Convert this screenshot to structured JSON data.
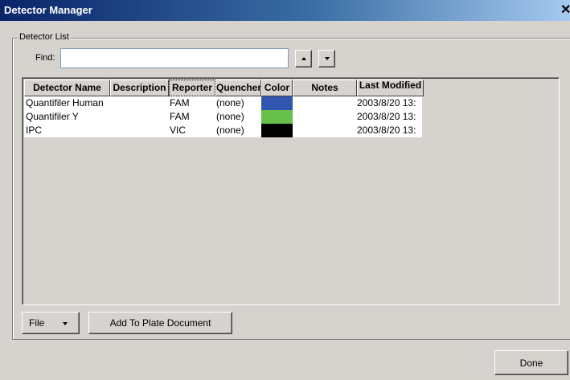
{
  "window": {
    "title": "Detector Manager",
    "close_symbol": "✕"
  },
  "group": {
    "legend": "Detector List"
  },
  "find": {
    "label": "Find:",
    "value": "",
    "placeholder": ""
  },
  "table": {
    "headers": [
      "Detector Name",
      "Description",
      "Reporter",
      "Quencher",
      "Color",
      "Notes",
      "Last Modified"
    ],
    "rows": [
      {
        "name": "Quantifiler Human",
        "description": "",
        "reporter": "FAM",
        "quencher": "(none)",
        "color": "#3056b0",
        "notes": "",
        "last_modified": "2003/8/20 13:"
      },
      {
        "name": "Quantifiler Y",
        "description": "",
        "reporter": "FAM",
        "quencher": "(none)",
        "color": "#66c04a",
        "notes": "",
        "last_modified": "2003/8/20 13:"
      },
      {
        "name": "IPC",
        "description": "",
        "reporter": "VIC",
        "quencher": "(none)",
        "color": "#000000",
        "notes": "",
        "last_modified": "2003/8/20 13:"
      }
    ]
  },
  "buttons": {
    "file": "File",
    "add_to_plate": "Add To Plate Document",
    "done": "Done"
  }
}
